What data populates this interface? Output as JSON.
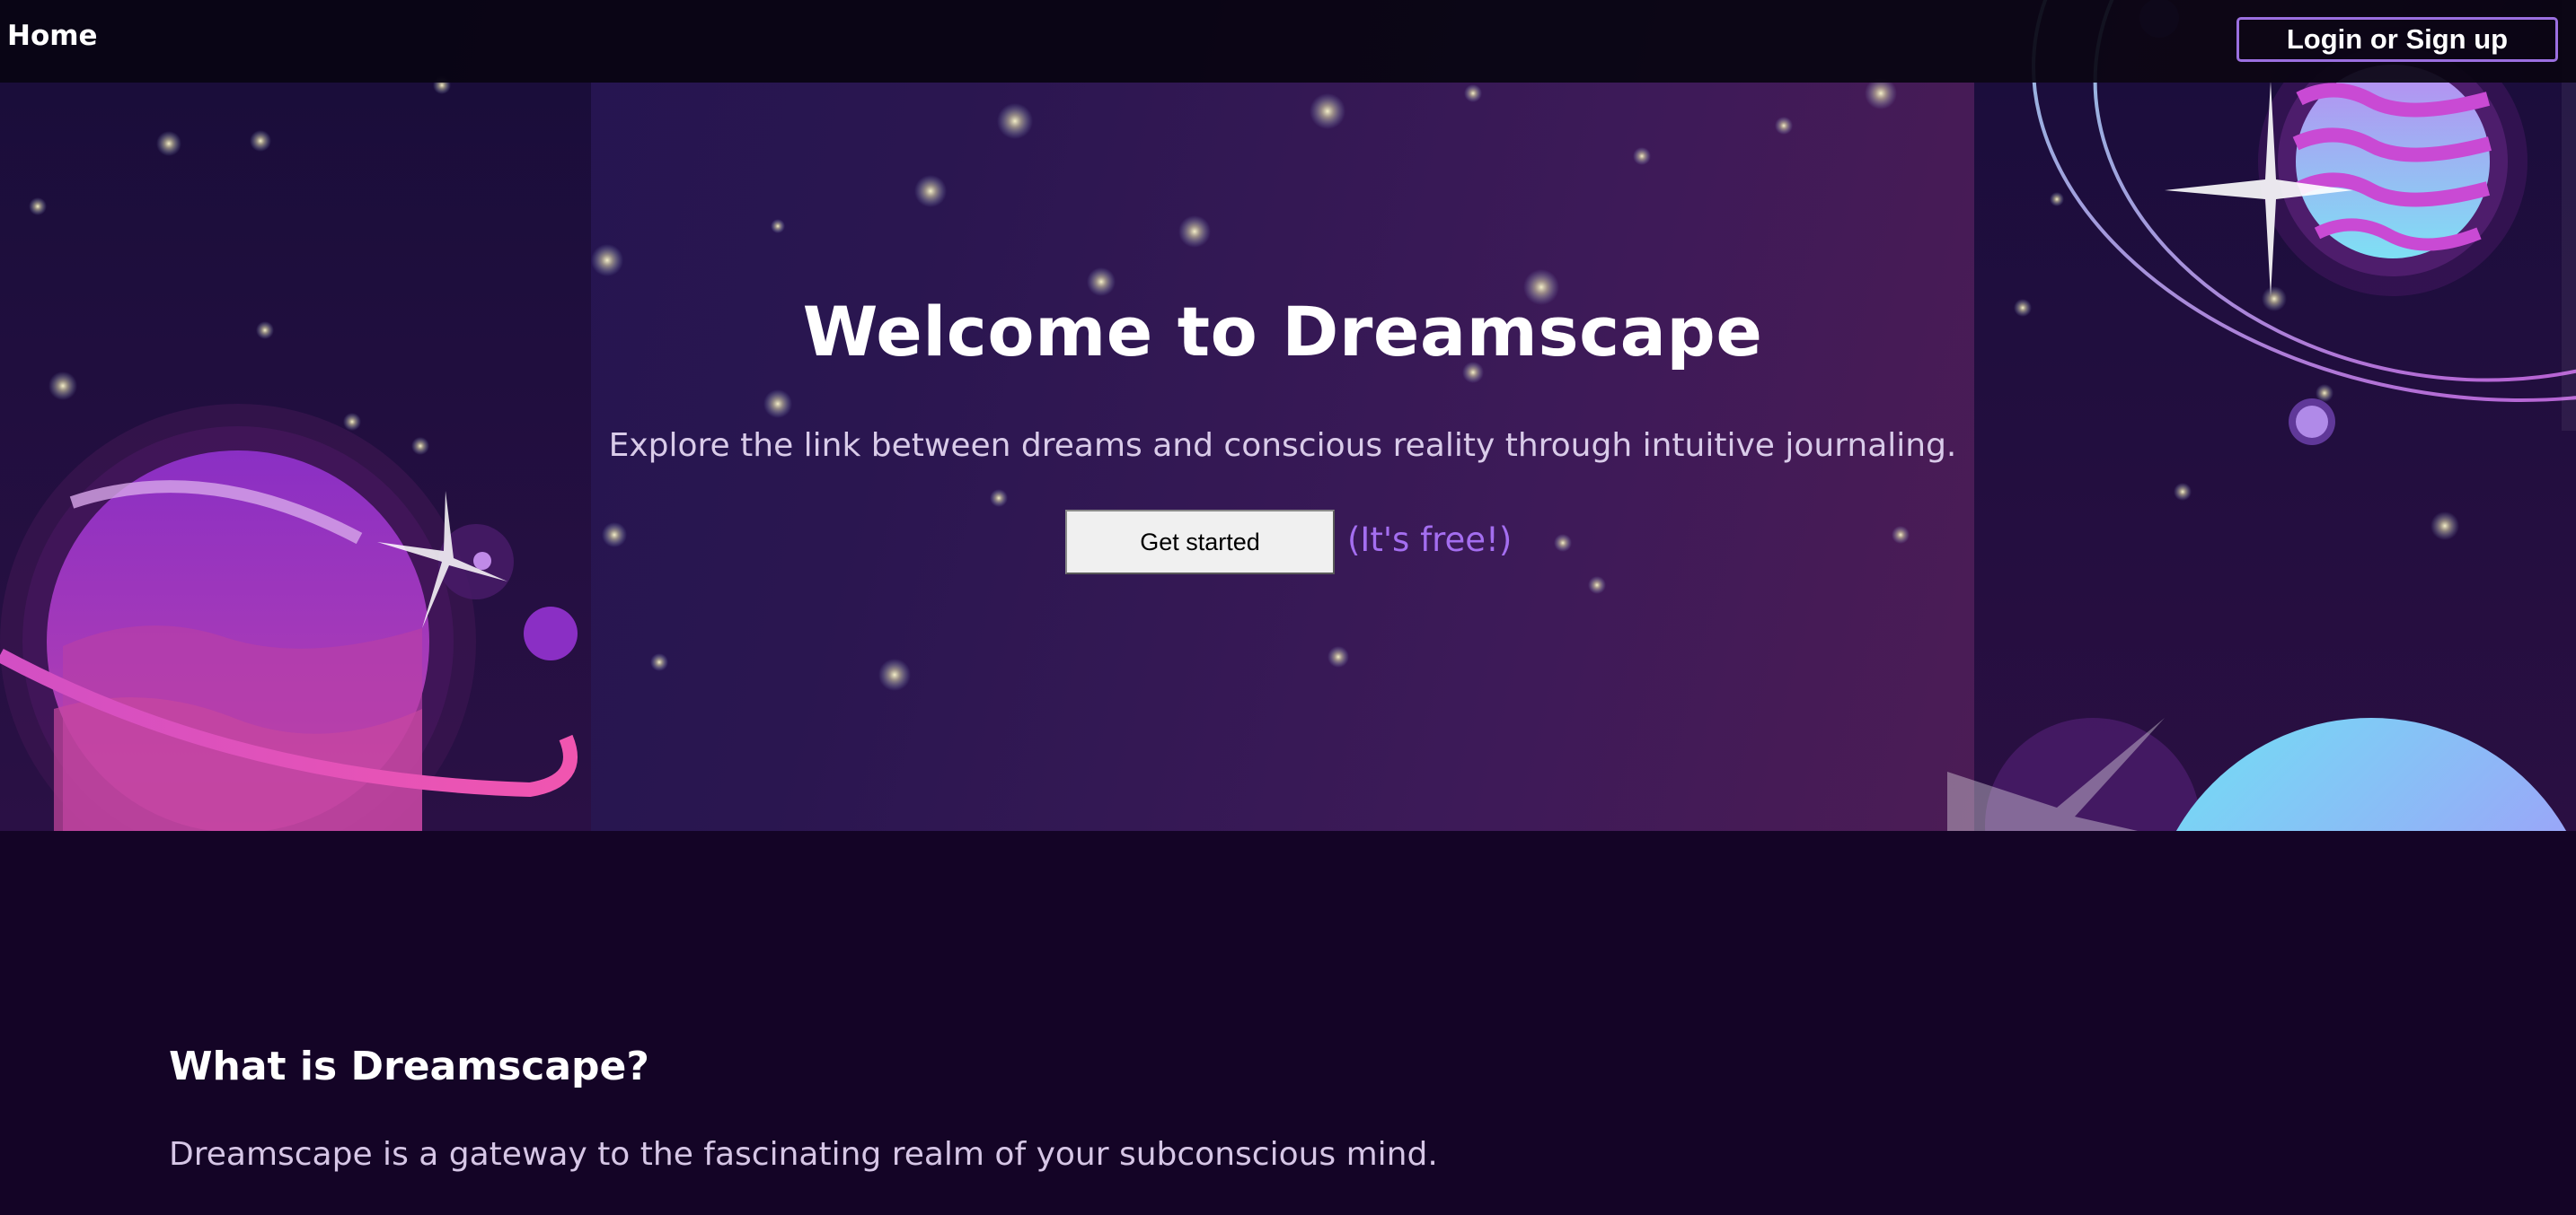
{
  "nav": {
    "home_label": "Home",
    "login_label": "Login or Sign up"
  },
  "hero": {
    "title": "Welcome to Dreamscape",
    "subtitle": "Explore the link between dreams and conscious reality through intuitive journaling.",
    "cta_label": "Get started",
    "cta_note": "(It's free!)"
  },
  "about": {
    "title": "What is Dreamscape?",
    "text": "Dreamscape is a gateway to the fascinating realm of your subconscious mind."
  },
  "colors": {
    "background": "#130424",
    "accent": "#a46ef0",
    "login_border": "#9b6fe0"
  }
}
